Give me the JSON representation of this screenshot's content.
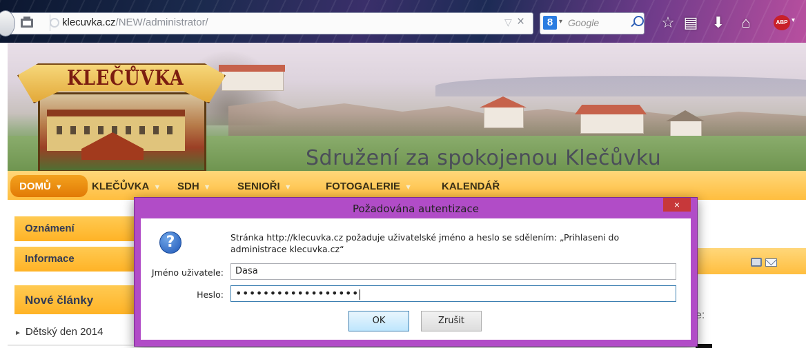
{
  "browser": {
    "url_host": "klecuvka.cz",
    "url_path": "/NEW/administrator/",
    "search_placeholder": "Google",
    "search_engine_letter": "8",
    "addon_badge": "ABP"
  },
  "site": {
    "logo_text": "KLEČŮVKA",
    "slogan": "Sdružení za spokojenou Klečůvku"
  },
  "nav": {
    "items": [
      {
        "label": "DOMŮ"
      },
      {
        "label": "KLEČŮVKA"
      },
      {
        "label": "SDH"
      },
      {
        "label": "SENIOŘI"
      },
      {
        "label": "FOTOGALERIE"
      },
      {
        "label": "KALENDÁŘ"
      }
    ]
  },
  "sidebar": {
    "boxes": [
      {
        "label": "Oznámení"
      },
      {
        "label": "Informace"
      }
    ],
    "heading": "Nové články",
    "links": [
      {
        "label": "Dětský den 2014"
      }
    ]
  },
  "content": {
    "fragment": "e:"
  },
  "dialog": {
    "title": "Požadována autentizace",
    "close": "×",
    "message": "Stránka http://klecuvka.cz požaduje uživatelské jméno a heslo se sdělením: „Prihlaseni do administrace klecuvka.cz“",
    "username_label": "Jméno uživatele:",
    "username_value": "Dasa",
    "password_label": "Heslo:",
    "password_value": "••••••••••••••••••",
    "ok_label": "OK",
    "cancel_label": "Zrušit"
  }
}
